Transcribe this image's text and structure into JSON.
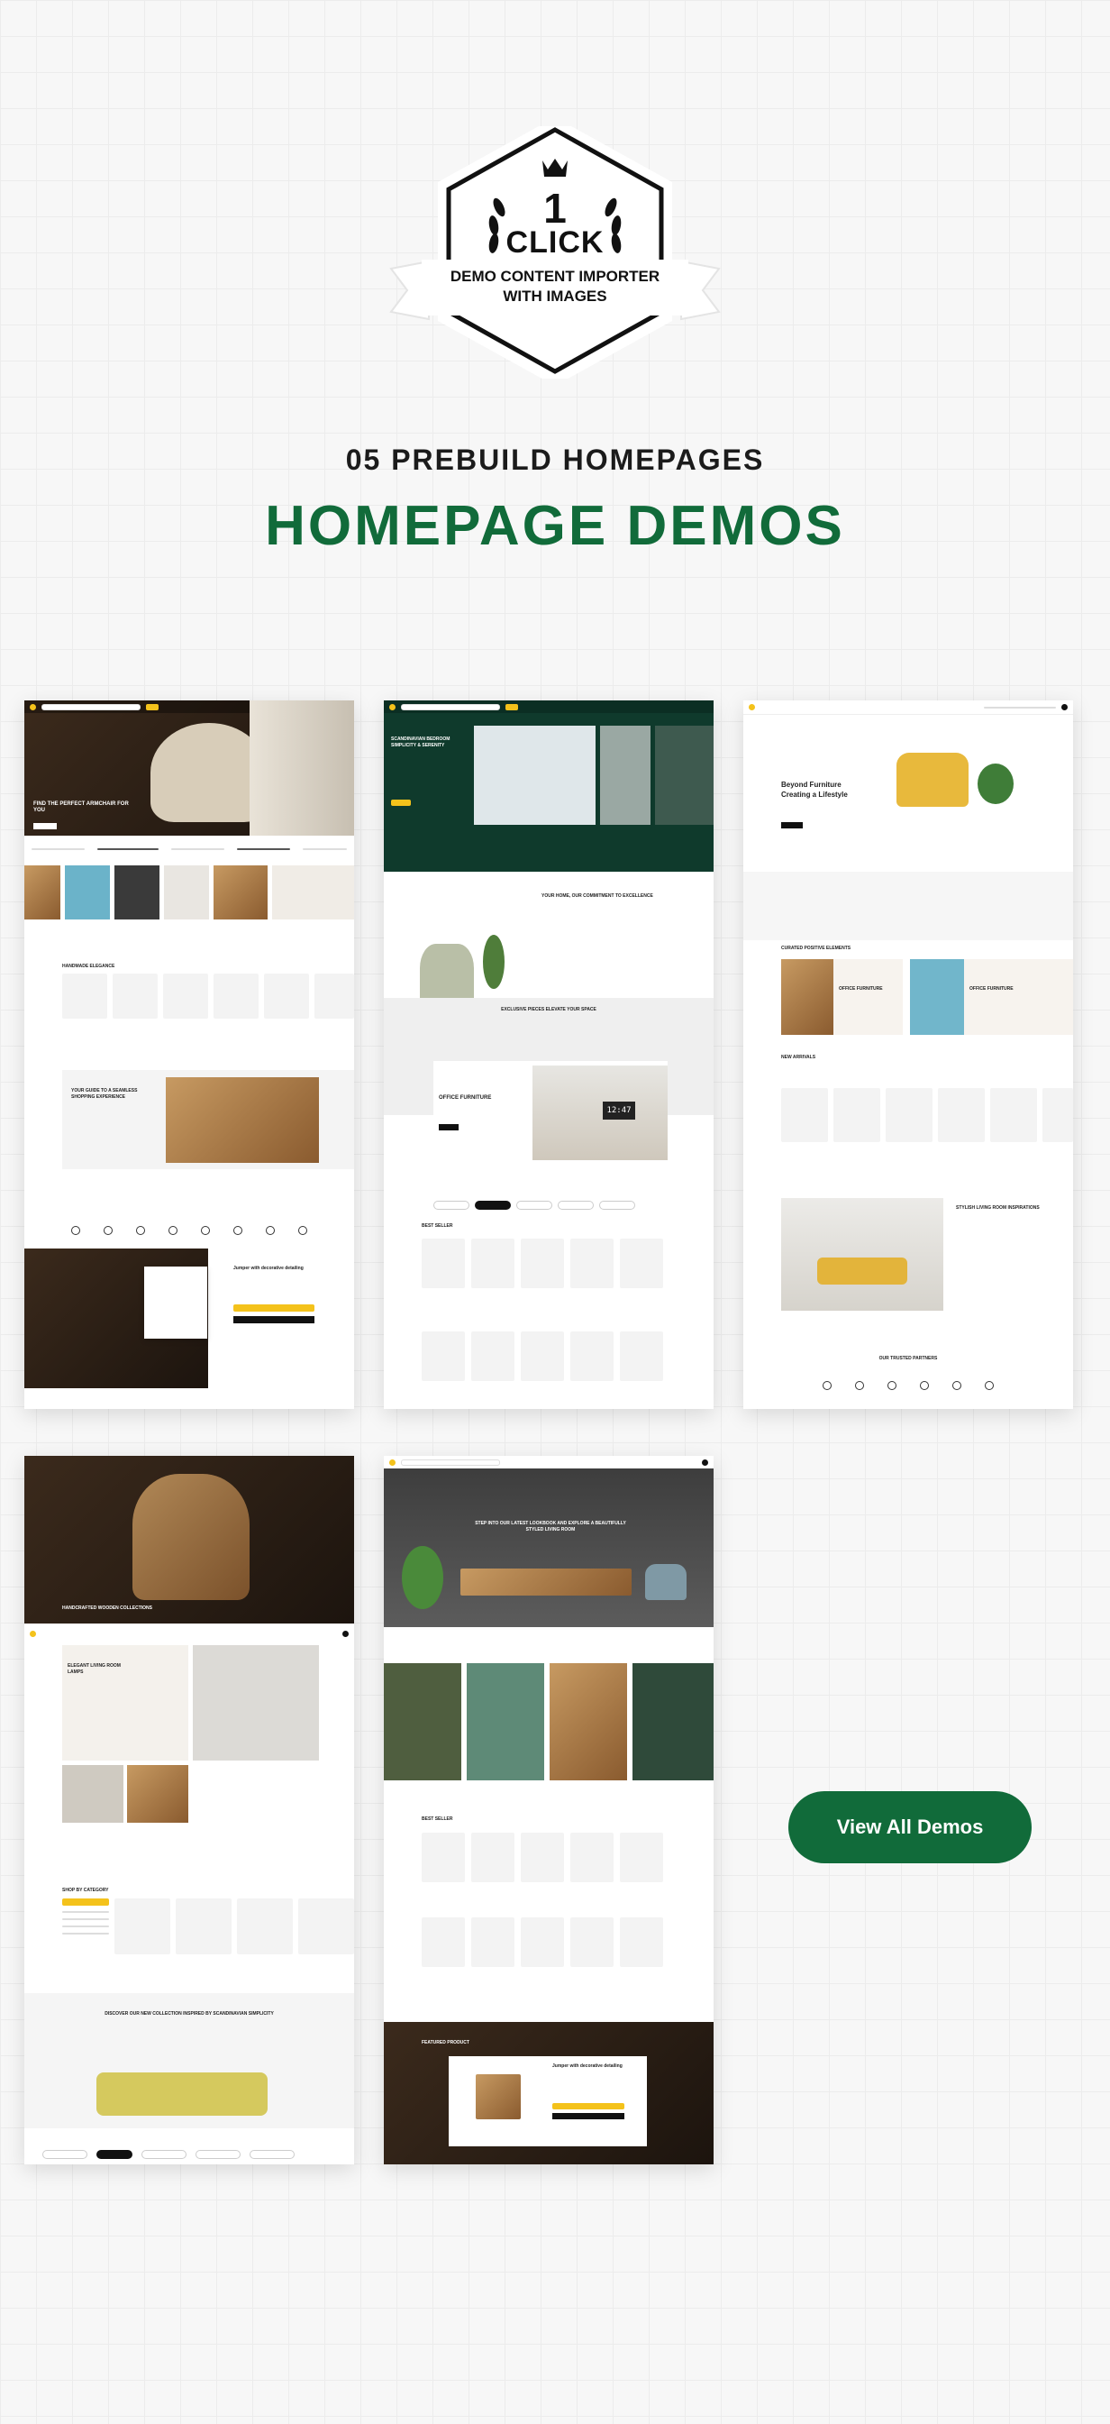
{
  "badge": {
    "number": "1",
    "word": "CLICK",
    "caption_line1": "DEMO CONTENT IMPORTER",
    "caption_line2": "WITH IMAGES"
  },
  "heading": {
    "subtitle": "05 PREBUILD HOMEPAGES",
    "title": "HOMEPAGE DEMOS"
  },
  "demos": [
    {
      "name": "demo-1",
      "hero_heading": "FIND THE PERFECT ARMCHAIR FOR YOU",
      "section_heading": "HANDMADE ELEGANCE",
      "guide_heading": "YOUR GUIDE TO A SEAMLESS SHOPPING EXPERIENCE",
      "product_title": "Jumper with decorative detailing"
    },
    {
      "name": "demo-2",
      "hero_heading": "SCANDINAVIAN BEDROOM SIMPLICITY & SERENITY",
      "section_heading": "YOUR HOME, OUR COMMITMENT TO EXCELLENCE",
      "banner_heading": "EXCLUSIVE PIECES ELEVATE YOUR SPACE",
      "office_heading": "OFFICE FURNITURE",
      "clock": "12:47",
      "list_heading": "BEST SELLER"
    },
    {
      "name": "demo-3",
      "hero_heading_line1": "Beyond Furniture",
      "hero_heading_line2": "Creating a Lifestyle",
      "section_heading": "CURATED POSITIVE ELEMENTS",
      "card1": "OFFICE FURNITURE",
      "card2": "OFFICE FURNITURE",
      "new_arrivals": "NEW ARRIVALS",
      "inspiration": "STYLISH LIVING ROOM INSPIRATIONS",
      "partners": "OUR TRUSTED PARTNERS"
    },
    {
      "name": "demo-4",
      "hero_heading": "HANDCRAFTED WOODEN COLLECTIONS",
      "collection_heading": "ELEGANT LIVING ROOM LAMPS",
      "category_heading": "SHOP BY CATEGORY",
      "banner_heading": "DISCOVER OUR NEW COLLECTION INSPIRED BY SCANDINAVIAN SIMPLICITY"
    },
    {
      "name": "demo-5",
      "hero_heading": "STEP INTO OUR LATEST LOOKBOOK AND EXPLORE A BEAUTIFULLY STYLED LIVING ROOM",
      "list_heading": "BEST SELLER",
      "featured_heading": "FEATURED PRODUCT",
      "product_title": "Jumper with decorative detailing"
    }
  ],
  "cta": {
    "label": "View All Demos"
  },
  "colors": {
    "brand_green": "#116b3a",
    "accent_yellow": "#f4c21b",
    "badge_dark": "#111111"
  }
}
